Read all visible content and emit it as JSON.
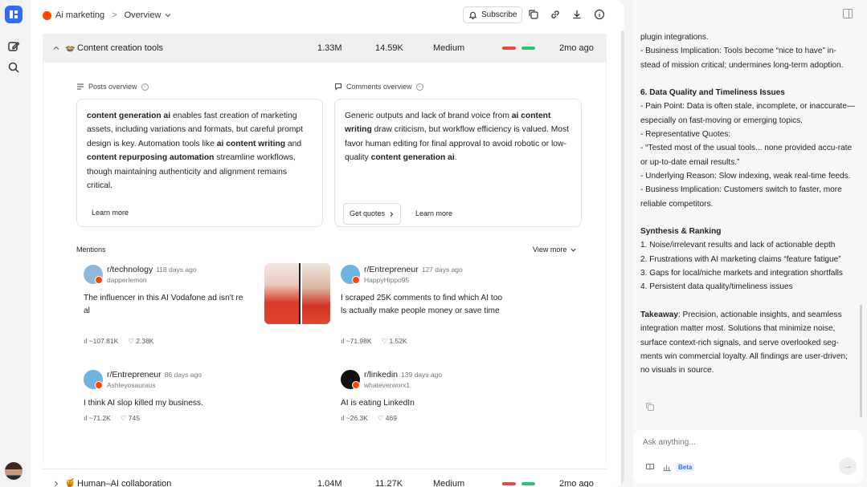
{
  "app": {
    "logo": "logo-icon"
  },
  "breadcrumb": {
    "root": "Ai marketing",
    "sep": ">",
    "current": "Overview"
  },
  "toolbar": {
    "subscribe": "Subscribe"
  },
  "rows": [
    {
      "title": "Content creation tools",
      "emoji": "🍲",
      "mentions": "1.33M",
      "engagement": "14.59K",
      "level": "Medium",
      "time": "2mo ago",
      "bar_colors": [
        "#e8463f",
        "#2fc36a"
      ]
    },
    {
      "title": "Human–AI collaboration",
      "emoji": "🍯",
      "mentions": "1.04M",
      "engagement": "11.27K",
      "level": "Medium",
      "time": "2mo ago",
      "bar_colors": [
        "#e8463f",
        "#2fc36a"
      ]
    }
  ],
  "posts_overview": {
    "label": "Posts overview",
    "parts": [
      {
        "b": true,
        "t": "content generation ai"
      },
      {
        "b": false,
        "t": " enables fast creation of marketing assets, including variations and formats, but careful prompt design is key. Automation tools like "
      },
      {
        "b": true,
        "t": "ai content writing"
      },
      {
        "b": false,
        "t": " and "
      },
      {
        "b": true,
        "t": "content repurposing automation"
      },
      {
        "b": false,
        "t": " streamline workflows, though maintaining authenticity and alignment remains critical."
      }
    ],
    "learn_more": "Learn more"
  },
  "comments_overview": {
    "label": "Comments overview",
    "parts": [
      {
        "b": false,
        "t": "Generic outputs and lack of brand voice from "
      },
      {
        "b": true,
        "t": "ai content writing"
      },
      {
        "b": false,
        "t": " draw criticism, but workflow efficiency is valued. Most favor human editing for final approval to avoid robotic or low-quality "
      },
      {
        "b": true,
        "t": "content generation ai"
      },
      {
        "b": false,
        "t": "."
      }
    ],
    "get_quotes": "Get quotes",
    "learn_more": "Learn more"
  },
  "mentions": {
    "label": "Mentions",
    "view_more": "View more",
    "items": [
      {
        "sub": "r/technology",
        "age": "118 days ago",
        "user": "dapperlemon",
        "text": "The influencer in this AI Vodafone ad isn't real",
        "views": "~107.81K",
        "likes": "2.38K",
        "avatar": "#8fb8d8"
      },
      {
        "sub": "r/Entrepreneur",
        "age": "127 days ago",
        "user": "HappyHippo95",
        "text": "I scraped 25K comments to find which AI tools actually make people money or save time",
        "views": "~71.98K",
        "likes": "1.52K",
        "avatar": "#6fb3e0"
      },
      {
        "sub": "r/Entrepreneur",
        "age": "86 days ago",
        "user": "Ashleyosauraus",
        "text": "I think AI slop killed my business.",
        "views": "~71.2K",
        "likes": "745",
        "avatar": "#6fb3e0"
      },
      {
        "sub": "r/linkedin",
        "age": "139 days ago",
        "user": "whateverworx1",
        "text": "AI is eating LinkedIn",
        "views": "~26.3K",
        "likes": "469",
        "avatar": "#111111"
      }
    ]
  },
  "right_panel": {
    "lines": [
      {
        "t": "plugin integrations.",
        "h": false
      },
      {
        "t": "- Business Implication: Tools become “nice to have” in-stead of mission critical; undermines long-term adoption.",
        "h": false
      },
      {
        "t": "",
        "h": false
      },
      {
        "t": "6. Data Quality and Timeliness Issues",
        "h": true
      },
      {
        "t": "- Pain Point: Data is often stale, incomplete, or inaccurate—especially on fast-moving or emerging topics.",
        "h": false
      },
      {
        "t": "- Representative Quotes:",
        "h": false
      },
      {
        "t": "- “Tested most of the usual tools... none provided accu-rate or up-to-date email results.”",
        "h": false
      },
      {
        "t": "- Underlying Reason: Slow indexing, weak real-time feeds.",
        "h": false
      },
      {
        "t": "- Business Implication: Customers switch to faster, more reliable competitors.",
        "h": false
      },
      {
        "t": "",
        "h": false
      },
      {
        "t": "Synthesis & Ranking",
        "h": true
      },
      {
        "t": "1. Noise/irrelevant results and lack of actionable depth",
        "h": false
      },
      {
        "t": "2. Frustrations with AI marketing claims “feature fatigue”",
        "h": false
      },
      {
        "t": "3. Gaps for local/niche markets and integration shortfalls",
        "h": false
      },
      {
        "t": "4. Persistent data quality/timeliness issues",
        "h": false
      },
      {
        "t": "",
        "h": false
      }
    ],
    "takeaway_label": "Takeaway",
    "takeaway_text": ": Precision, actionable insights, and seamless integration matter most. Solutions that minimize noise, surface context-rich signals, and serve overlooked seg-ments win commercial loyalty. All findings are user-driven; no visuals in source."
  },
  "ask": {
    "placeholder": "Ask anything...",
    "beta": "Beta"
  }
}
